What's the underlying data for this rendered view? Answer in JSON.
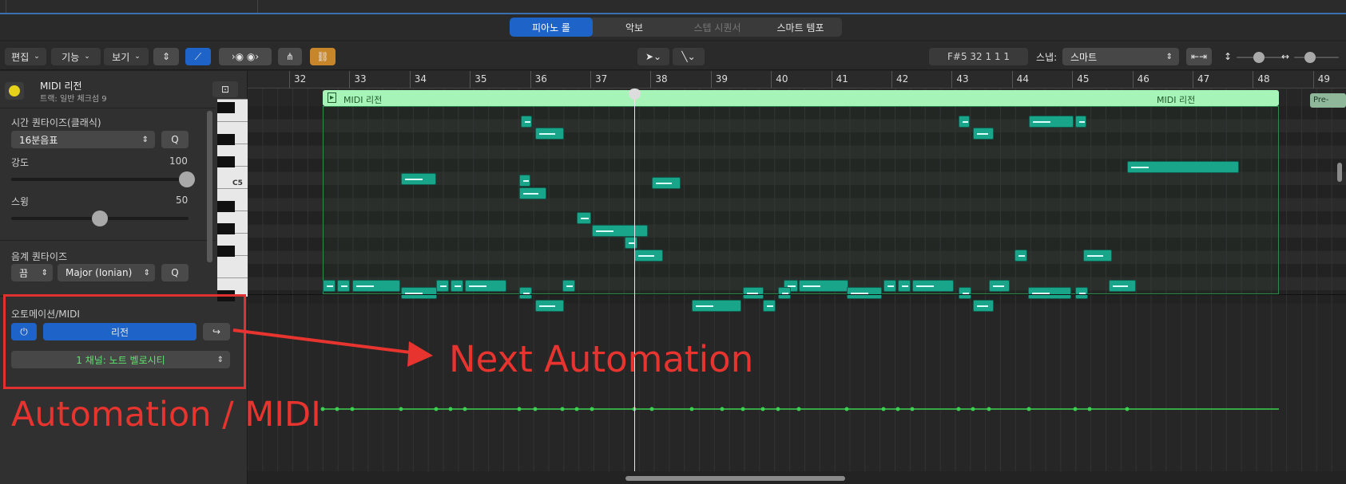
{
  "tabs": [
    {
      "label": "피아노 롤",
      "state": "active"
    },
    {
      "label": "악보",
      "state": "normal"
    },
    {
      "label": "스텝 시퀀서",
      "state": "dim"
    },
    {
      "label": "스마트 템포",
      "state": "normal"
    }
  ],
  "toolbar": {
    "menus": [
      "편집",
      "기능",
      "보기"
    ],
    "position_readout": "F#5   32 1 1 1",
    "snap_label": "스냅:",
    "snap_value": "스마트"
  },
  "region": {
    "title": "MIDI 리전",
    "subtitle": "트랙: 일반 체크섬 9"
  },
  "time_quantize": {
    "label": "시간 퀀타이즈(클래식)",
    "value": "16분음표",
    "q_label": "Q",
    "strength_label": "강도",
    "strength_value": "100",
    "strength_level": 1.0,
    "swing_label": "스윙",
    "swing_value": "50",
    "swing_level": 0.5
  },
  "scale_quantize": {
    "label": "음계 퀀타이즈",
    "root": "끔",
    "scale": "Major (Ionian)",
    "q_label": "Q"
  },
  "automation": {
    "label": "오토메이션/MIDI",
    "mode": "리전",
    "channel": "1 채널: 노트 벨로시티"
  },
  "piano": {
    "c_label": "C5"
  },
  "ruler": {
    "bars": [
      "32",
      "33",
      "34",
      "35",
      "36",
      "37",
      "38",
      "39",
      "40",
      "41",
      "42",
      "43",
      "44",
      "45",
      "46",
      "47",
      "48",
      "49"
    ]
  },
  "region_header": {
    "left_label": "MIDI 리전",
    "right_label": "MIDI 리전",
    "next_label": "Pre-"
  },
  "annotations": {
    "next": "Next Automation",
    "automation_midi": "Automation / MIDI"
  },
  "colors": {
    "accent": "#1e64c8",
    "note": "#19a58a",
    "region": "#a7f4b9",
    "automation_line": "#3cd050",
    "annotation": "#e8342f",
    "link_button": "#c8862a"
  },
  "icons": [
    "metronome-icon",
    "catch-icon",
    "midi-in-icon",
    "pointer-tool-icon",
    "pencil-tool-icon",
    "link-icon",
    "zoom-fit-icon",
    "vertical-zoom-icon",
    "horizontal-zoom-icon",
    "power-icon",
    "next-arrow-icon"
  ]
}
